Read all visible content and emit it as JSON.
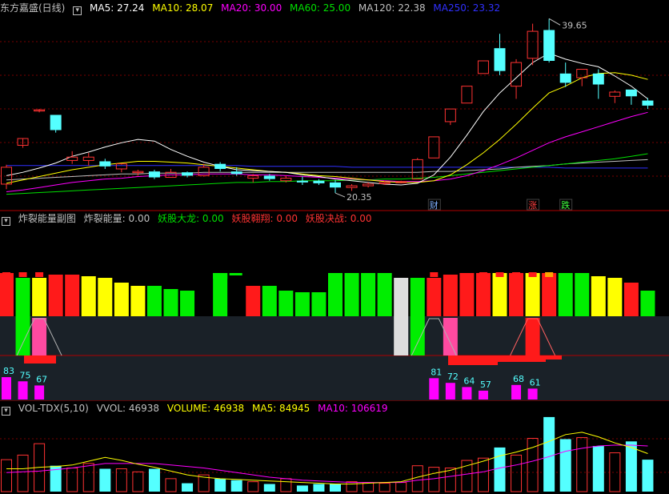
{
  "panel1": {
    "title": "东方嘉盛(日线)",
    "ma5_label": "MA5: 27.24",
    "ma10_label": "MA10: 28.07",
    "ma20_label": "MA20: 30.00",
    "ma60_label": "MA60: 25.00",
    "ma120_label": "MA120: 22.38",
    "ma250_label": "MA250: 23.32",
    "high_label": "39.65",
    "low_label": "20.35",
    "markers": [
      {
        "text": "财",
        "index": 26,
        "color": "#7fb0ff"
      },
      {
        "text": "涨",
        "index": 32,
        "color": "#ff4040"
      },
      {
        "text": "跌",
        "index": 34,
        "color": "#40ff40"
      }
    ]
  },
  "panel2": {
    "title": "炸裂能量副图",
    "label_energy": "炸裂能量: 0.00",
    "label_dragon": "妖股大龙: 0.00",
    "label_soar": "妖股翱翔: 0.00",
    "label_battle": "妖股决战: 0.00"
  },
  "panel3": {
    "title": "VOL-TDX(5,10)",
    "vvol_label": "VVOL: 46938",
    "volume_label": "VOLUME: 46938",
    "ma5_label": "MA5: 84945",
    "ma10_label": "MA10: 106619"
  },
  "colors": {
    "up": "#ff3232",
    "down": "#54ffff",
    "ma5": "#ffffff",
    "ma10": "#ffff00",
    "ma20": "#ff00ff",
    "ma60": "#00e000",
    "ma120": "#c0c0c0",
    "ma250": "#3030ff",
    "grid": "#7a0000",
    "sep": "#b00000"
  },
  "chart_data": [
    {
      "type": "candlestick",
      "title": "东方嘉盛(日线)",
      "y_range": [
        19.5,
        41.5
      ],
      "candles": [
        {
          "o": 21.4,
          "h": 23.7,
          "l": 20.8,
          "c": 23.4
        },
        {
          "o": 26.0,
          "h": 26.1,
          "l": 25.7,
          "c": 26.8
        },
        {
          "o": 30.2,
          "h": 30.3,
          "l": 29.9,
          "c": 30.2
        },
        {
          "o": 29.6,
          "h": 29.6,
          "l": 27.5,
          "c": 27.8
        },
        {
          "o": 24.2,
          "h": 25.3,
          "l": 23.8,
          "c": 24.6
        },
        {
          "o": 24.2,
          "h": 25.1,
          "l": 23.6,
          "c": 24.6
        },
        {
          "o": 24.1,
          "h": 24.4,
          "l": 23.2,
          "c": 23.5
        },
        {
          "o": 23.2,
          "h": 23.7,
          "l": 22.8,
          "c": 23.8
        },
        {
          "o": 22.8,
          "h": 23.1,
          "l": 22.4,
          "c": 22.9
        },
        {
          "o": 22.9,
          "h": 23.1,
          "l": 22.0,
          "c": 22.2
        },
        {
          "o": 22.2,
          "h": 23.2,
          "l": 22.2,
          "c": 22.8
        },
        {
          "o": 22.8,
          "h": 22.9,
          "l": 22.2,
          "c": 22.4
        },
        {
          "o": 22.4,
          "h": 23.8,
          "l": 22.3,
          "c": 23.4
        },
        {
          "o": 23.8,
          "h": 24.0,
          "l": 22.9,
          "c": 23.2
        },
        {
          "o": 22.9,
          "h": 23.4,
          "l": 22.4,
          "c": 22.6
        },
        {
          "o": 22.1,
          "h": 22.6,
          "l": 21.6,
          "c": 22.4
        },
        {
          "o": 22.4,
          "h": 22.6,
          "l": 21.8,
          "c": 22.0
        },
        {
          "o": 21.8,
          "h": 22.4,
          "l": 21.6,
          "c": 22.1
        },
        {
          "o": 21.8,
          "h": 22.3,
          "l": 21.3,
          "c": 21.6
        },
        {
          "o": 21.8,
          "h": 22.0,
          "l": 21.3,
          "c": 21.5
        },
        {
          "o": 21.6,
          "h": 21.9,
          "l": 20.35,
          "c": 21.0
        },
        {
          "o": 21.0,
          "h": 21.4,
          "l": 20.6,
          "c": 21.2
        },
        {
          "o": 21.2,
          "h": 21.6,
          "l": 21.0,
          "c": 21.4
        },
        {
          "o": 21.5,
          "h": 21.8,
          "l": 21.3,
          "c": 21.6
        },
        {
          "o": 21.6,
          "h": 21.8,
          "l": 21.5,
          "c": 21.7
        },
        {
          "o": 22.0,
          "h": 24.5,
          "l": 22.0,
          "c": 24.3
        },
        {
          "o": 24.5,
          "h": 27.0,
          "l": 24.5,
          "c": 27.0
        },
        {
          "o": 28.8,
          "h": 30.3,
          "l": 28.4,
          "c": 30.3
        },
        {
          "o": 31.0,
          "h": 33.0,
          "l": 31.0,
          "c": 33.0
        },
        {
          "o": 34.5,
          "h": 36.0,
          "l": 34.5,
          "c": 36.0
        },
        {
          "o": 37.5,
          "h": 39.2,
          "l": 34.3,
          "c": 34.8
        },
        {
          "o": 33.0,
          "h": 36.2,
          "l": 31.5,
          "c": 35.8
        },
        {
          "o": 36.3,
          "h": 40.4,
          "l": 35.5,
          "c": 39.5
        },
        {
          "o": 39.65,
          "h": 41.0,
          "l": 35.8,
          "c": 36.0
        },
        {
          "o": 34.5,
          "h": 35.8,
          "l": 32.9,
          "c": 33.4
        },
        {
          "o": 34.0,
          "h": 35.0,
          "l": 33.0,
          "c": 35.0
        },
        {
          "o": 34.5,
          "h": 35.0,
          "l": 31.5,
          "c": 33.2
        },
        {
          "o": 31.8,
          "h": 32.5,
          "l": 31.0,
          "c": 32.3
        },
        {
          "o": 32.6,
          "h": 32.6,
          "l": 30.8,
          "c": 31.8
        },
        {
          "o": 31.3,
          "h": 31.6,
          "l": 30.3,
          "c": 30.7
        }
      ],
      "ma5": [
        22.4,
        22.8,
        23.3,
        23.9,
        24.7,
        25.2,
        25.8,
        26.3,
        26.7,
        26.5,
        25.5,
        24.7,
        24.0,
        23.5,
        23.1,
        23.0,
        22.9,
        22.8,
        22.5,
        22.3,
        22.0,
        21.8,
        21.6,
        21.4,
        21.3,
        21.5,
        22.5,
        24.6,
        27.2,
        30.0,
        32.2,
        34.0,
        35.8,
        36.9,
        36.2,
        35.7,
        35.3,
        34.2,
        33.0,
        31.5
      ],
      "ma10": [
        21.5,
        21.9,
        22.3,
        22.7,
        23.1,
        23.4,
        23.7,
        23.9,
        24.1,
        24.1,
        24.0,
        23.9,
        23.7,
        23.5,
        23.3,
        23.1,
        22.9,
        22.8,
        22.6,
        22.4,
        22.3,
        22.1,
        21.9,
        21.7,
        21.6,
        21.6,
        21.8,
        22.5,
        23.7,
        25.1,
        26.7,
        28.5,
        30.4,
        32.2,
        33.0,
        34.0,
        34.5,
        34.6,
        34.3,
        33.8
      ],
      "ma20": [
        20.5,
        20.7,
        21.0,
        21.3,
        21.6,
        21.8,
        22.0,
        22.1,
        22.3,
        22.4,
        22.5,
        22.5,
        22.6,
        22.6,
        22.6,
        22.5,
        22.5,
        22.4,
        22.3,
        22.2,
        22.1,
        22.0,
        21.9,
        21.8,
        21.7,
        21.7,
        21.8,
        22.0,
        22.4,
        23.0,
        23.7,
        24.5,
        25.4,
        26.3,
        27.0,
        27.6,
        28.2,
        28.8,
        29.4,
        29.9
      ],
      "ma60": [
        20.2,
        20.3,
        20.4,
        20.5,
        20.6,
        20.7,
        20.8,
        20.9,
        21.0,
        21.1,
        21.2,
        21.3,
        21.4,
        21.5,
        21.6,
        21.6,
        21.7,
        21.7,
        21.8,
        21.8,
        21.8,
        21.9,
        21.9,
        22.0,
        22.0,
        22.1,
        22.2,
        22.4,
        22.6,
        22.8,
        23.0,
        23.2,
        23.4,
        23.6,
        23.8,
        24.0,
        24.2,
        24.4,
        24.7,
        25.0
      ],
      "ma120": [
        21.9,
        22.0,
        22.1,
        22.2,
        22.3,
        22.4,
        22.5,
        22.6,
        22.6,
        22.7,
        22.7,
        22.7,
        22.8,
        22.8,
        22.8,
        22.8,
        22.8,
        22.8,
        22.8,
        22.8,
        22.8,
        22.8,
        22.8,
        22.8,
        22.8,
        22.8,
        22.9,
        22.9,
        23.0,
        23.1,
        23.2,
        23.4,
        23.5,
        23.6,
        23.8,
        23.9,
        24.0,
        24.1,
        24.2,
        24.3
      ],
      "ma250": [
        23.6,
        23.6,
        23.6,
        23.6,
        23.6,
        23.6,
        23.6,
        23.6,
        23.6,
        23.6,
        23.6,
        23.6,
        23.6,
        23.6,
        23.6,
        23.5,
        23.5,
        23.5,
        23.5,
        23.5,
        23.5,
        23.4,
        23.4,
        23.4,
        23.4,
        23.4,
        23.4,
        23.4,
        23.4,
        23.4,
        23.4,
        23.4,
        23.4,
        23.4,
        23.3,
        23.3,
        23.3,
        23.3,
        23.3,
        23.3
      ]
    },
    {
      "type": "bar",
      "title": "炸裂能量副图",
      "bar_top_px": [
        [
          341,
          "#ff1a1a",
          395
        ],
        [
          347,
          "#00ee00",
          447
        ],
        [
          347,
          "#ffff00",
          395
        ],
        [
          343,
          "#ff1a1a",
          395
        ],
        [
          343,
          "#ff1a1a",
          395
        ],
        [
          345,
          "#ffff00",
          395
        ],
        [
          347,
          "#ffff00",
          395
        ],
        [
          353,
          "#ffff00",
          395
        ],
        [
          357,
          "#ffff00",
          395
        ],
        [
          357,
          "#00ee00",
          395
        ],
        [
          361,
          "#00ee00",
          395
        ],
        [
          363,
          "#00ee00",
          395
        ]
      ]
    },
    {
      "type": "bar",
      "title": "VOL-TDX(5,10)",
      "volumes": [
        42,
        48,
        63,
        34,
        31,
        37,
        30,
        30,
        26,
        30,
        17,
        11,
        22,
        17,
        15,
        13,
        10,
        17,
        8,
        10,
        10,
        13,
        12,
        11,
        12,
        34,
        32,
        31,
        41,
        44,
        58,
        48,
        70,
        98,
        69,
        71,
        60,
        51,
        66,
        42
      ],
      "ma5": [
        30,
        30,
        32,
        33,
        35,
        40,
        45,
        41,
        36,
        32,
        27,
        22,
        19,
        17,
        16,
        15,
        14,
        13,
        12,
        11,
        10,
        10,
        11,
        12,
        13,
        19,
        24,
        28,
        34,
        40,
        47,
        52,
        58,
        66,
        75,
        78,
        72,
        64,
        58,
        50
      ],
      "ma10": [
        25,
        26,
        27,
        29,
        31,
        34,
        37,
        37,
        37,
        37,
        35,
        33,
        31,
        28,
        25,
        22,
        19,
        17,
        15,
        14,
        13,
        12,
        12,
        12,
        12,
        15,
        17,
        20,
        23,
        26,
        31,
        35,
        40,
        46,
        53,
        57,
        60,
        61,
        61,
        60
      ]
    }
  ]
}
